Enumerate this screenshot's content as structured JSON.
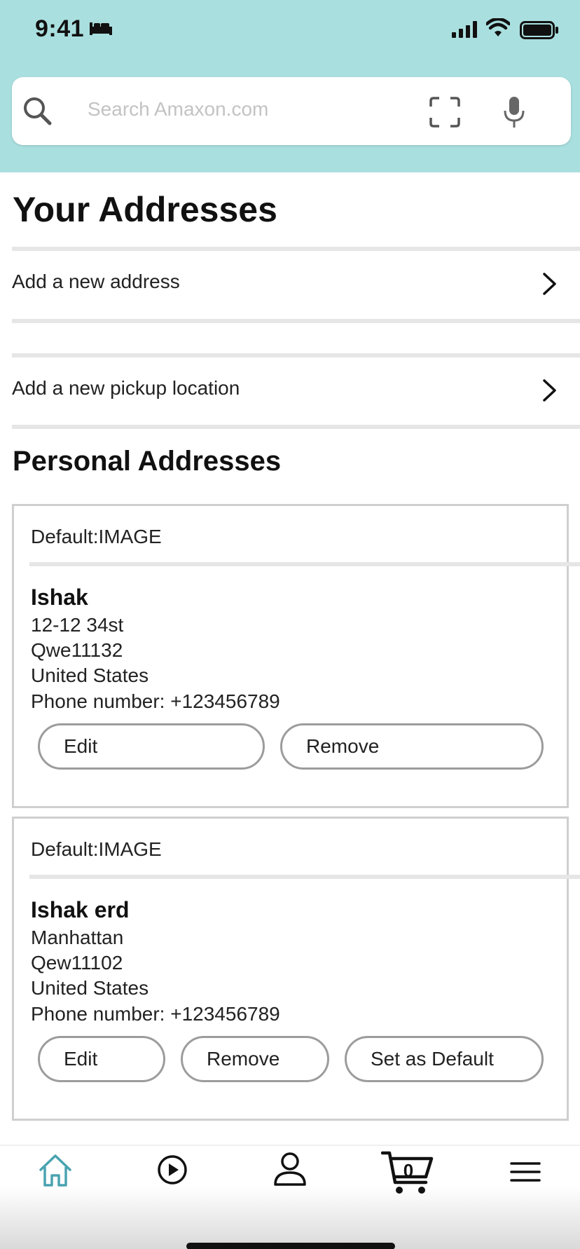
{
  "status_bar": {
    "time": "9:41"
  },
  "search": {
    "placeholder": "Search Amaxon.com"
  },
  "page": {
    "title": "Your Addresses",
    "add_address_label": "Add a new address",
    "add_pickup_label": "Add a new pickup location",
    "section_title": "Personal Addresses"
  },
  "addresses": [
    {
      "default_label": "Default:IMAGE",
      "name": "Ishak",
      "line1": "12-12 34st",
      "line2": "Qwe11132",
      "country": "United States",
      "phone": "Phone number: +123456789",
      "edit_label": "Edit",
      "remove_label": "Remove"
    },
    {
      "default_label": "Default:IMAGE",
      "name": "Ishak erd",
      "line1": "Manhattan",
      "line2": "Qew11102",
      "country": "United States",
      "phone": "Phone number: +123456789",
      "edit_label": "Edit",
      "remove_label": "Remove",
      "set_default_label": "Set as Default"
    }
  ],
  "bottom_nav": {
    "cart_count": "0",
    "items": [
      "home-icon",
      "video-icon",
      "account-icon",
      "cart-icon",
      "menu-icon"
    ],
    "active_color": "#4aa3b0"
  }
}
